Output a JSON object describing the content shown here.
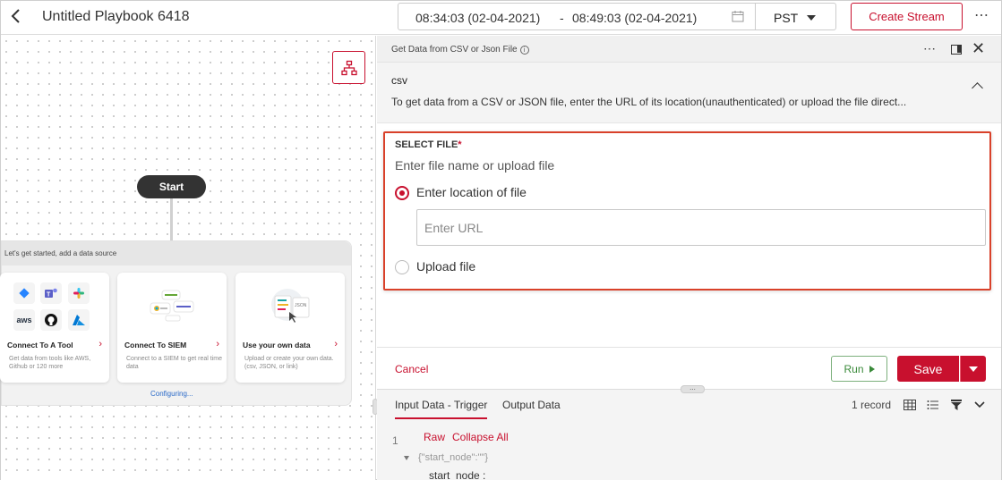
{
  "header": {
    "title": "Untitled Playbook 6418",
    "date_start": "08:34:03 (02-04-2021)",
    "date_sep": "-",
    "date_end": "08:49:03 (02-04-2021)",
    "timezone": "PST",
    "create_stream_label": "Create Stream",
    "more_label": "⋯"
  },
  "canvas": {
    "start_label": "Start",
    "source_panel_title": "Let's get started, add a data source",
    "cards": [
      {
        "title": "Connect To A Tool",
        "desc": "Get data from tools like AWS, Github or 120 more"
      },
      {
        "title": "Connect To SIEM",
        "desc": "Connect to a SIEM to get real time data"
      },
      {
        "title": "Use your own data",
        "desc": "Upload or create your own data. (csv, JSON, or link)"
      }
    ],
    "configuring_label": "Configuring...",
    "tool_icons": [
      "aws",
      "github",
      "azure",
      "jira",
      "teams",
      "slack"
    ]
  },
  "panel": {
    "top_label": "Get Data from CSV or Json File",
    "section_name": "csv",
    "section_desc": "To get data from a CSV or JSON file, enter the URL of its location(unauthenticated) or upload the file direct...",
    "select_file_label": "SELECT FILE",
    "required_mark": "*",
    "select_file_hint": "Enter file name or upload file",
    "option_location": "Enter location of file",
    "url_placeholder": "Enter URL",
    "option_upload": "Upload file",
    "cancel_label": "Cancel",
    "run_label": "Run",
    "save_label": "Save"
  },
  "data": {
    "tab_input": "Input Data - Trigger",
    "tab_output": "Output Data",
    "record_count": "1 record",
    "line_number": "1",
    "raw_label": "Raw",
    "collapse_label": "Collapse All",
    "json_preview": "{\"start_node\":\"\"}",
    "json_key": "start_node :"
  },
  "colors": {
    "accent": "#c8102e",
    "run_green": "#3a8a3a",
    "link_blue": "#2a6ac8"
  }
}
